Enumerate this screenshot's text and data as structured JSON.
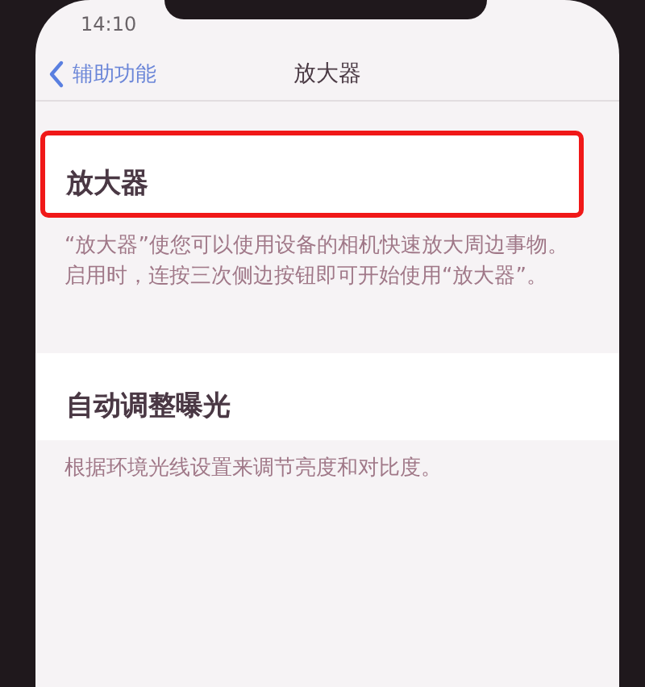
{
  "status_bar": {
    "time": "14:10"
  },
  "nav": {
    "back_label": "辅助功能",
    "title": "放大器"
  },
  "sections": [
    {
      "title": "放大器",
      "highlighted": true,
      "description": "“放大器”使您可以使用设备的相机快速放大周边事物。启用时，连按三次侧边按钮即可开始使用“放大器”。"
    },
    {
      "title": "自动调整曝光",
      "highlighted": false,
      "description": "根据环境光线设置来调节亮度和对比度。"
    }
  ]
}
